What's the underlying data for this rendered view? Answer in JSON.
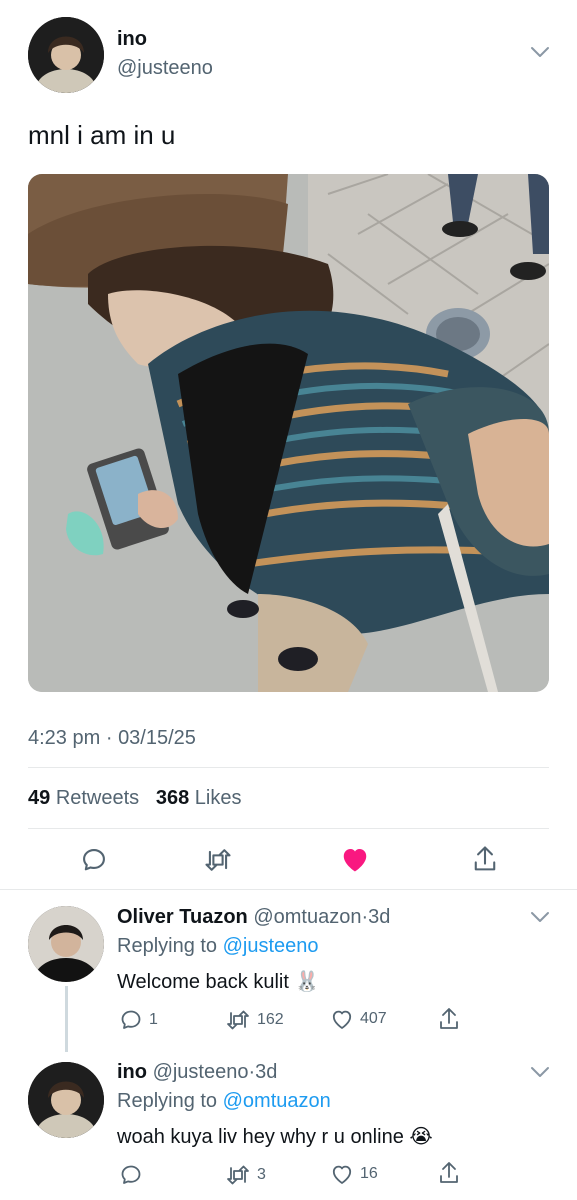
{
  "tweet": {
    "display_name": "ino",
    "handle": "@justeeno",
    "text": "mnl i am in u",
    "time": "4:23 pm",
    "dot": "·",
    "date": "03/15/25",
    "retweets_count": "49",
    "retweets_label": "Retweets",
    "likes_count": "368",
    "likes_label": "Likes"
  },
  "replies": [
    {
      "display_name": "Oliver Tuazon",
      "handle": "@omtuazon",
      "dot": "·",
      "age": "3d",
      "replying_prefix": "Replying to",
      "replying_to": "@justeeno",
      "text": "Welcome back kulit",
      "emoji": "🐰",
      "comments": "1",
      "retweets": "162",
      "likes": "407"
    },
    {
      "display_name": "ino",
      "handle": "@justeeno",
      "dot": "·",
      "age": "3d",
      "replying_prefix": "Replying to",
      "replying_to": "@omtuazon",
      "text": "woah kuya liv hey why r u online",
      "emoji": "😭",
      "comments": "",
      "retweets": "3",
      "likes": "16"
    }
  ],
  "colors": {
    "like_active": "#f91880",
    "link": "#1d9bf0",
    "muted": "#536471"
  },
  "icons": [
    "chevron-down-icon",
    "comment-icon",
    "retweet-icon",
    "heart-filled-icon",
    "heart-outline-icon",
    "share-icon"
  ]
}
